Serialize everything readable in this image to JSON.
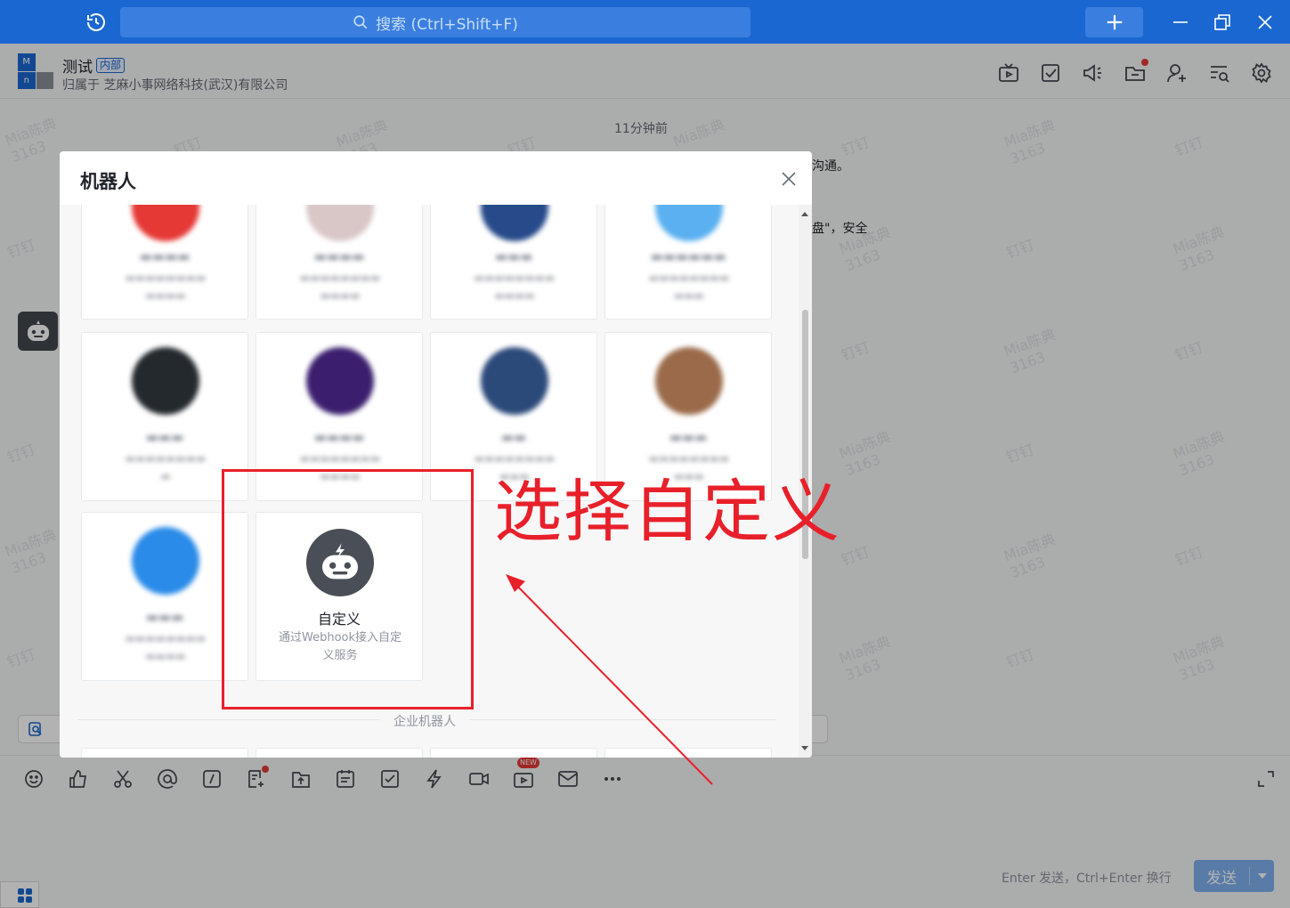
{
  "titlebar": {
    "search_placeholder": "搜索 (Ctrl+Shift+F)"
  },
  "chat_header": {
    "group_name": "测试",
    "group_badge": "内部",
    "group_owner": "归属于 芝麻小事网络科技(武汉)有限公司",
    "avatar_letters": [
      "M",
      "",
      "n",
      ""
    ]
  },
  "chat": {
    "time": "11分钟前",
    "fragment_1": "沟通。",
    "fragment_2": "盘\"，安全"
  },
  "watermark": {
    "name": "Mia陈典",
    "id": "3163",
    "brand": "钉钉"
  },
  "modal": {
    "title": "机器人",
    "custom_robot": {
      "title": "自定义",
      "description": "通过Webhook接入自定义服务"
    },
    "section_label": "企业机器人"
  },
  "composer": {
    "new_badge": "NEW",
    "send_hint": "Enter 发送，Ctrl+Enter 换行",
    "send_label": "发送"
  },
  "annotation": {
    "text": "选择自定义"
  },
  "colors": {
    "titlebar": "#1a67d1",
    "accent": "#1a67d1",
    "annotation": "#e8202a"
  }
}
